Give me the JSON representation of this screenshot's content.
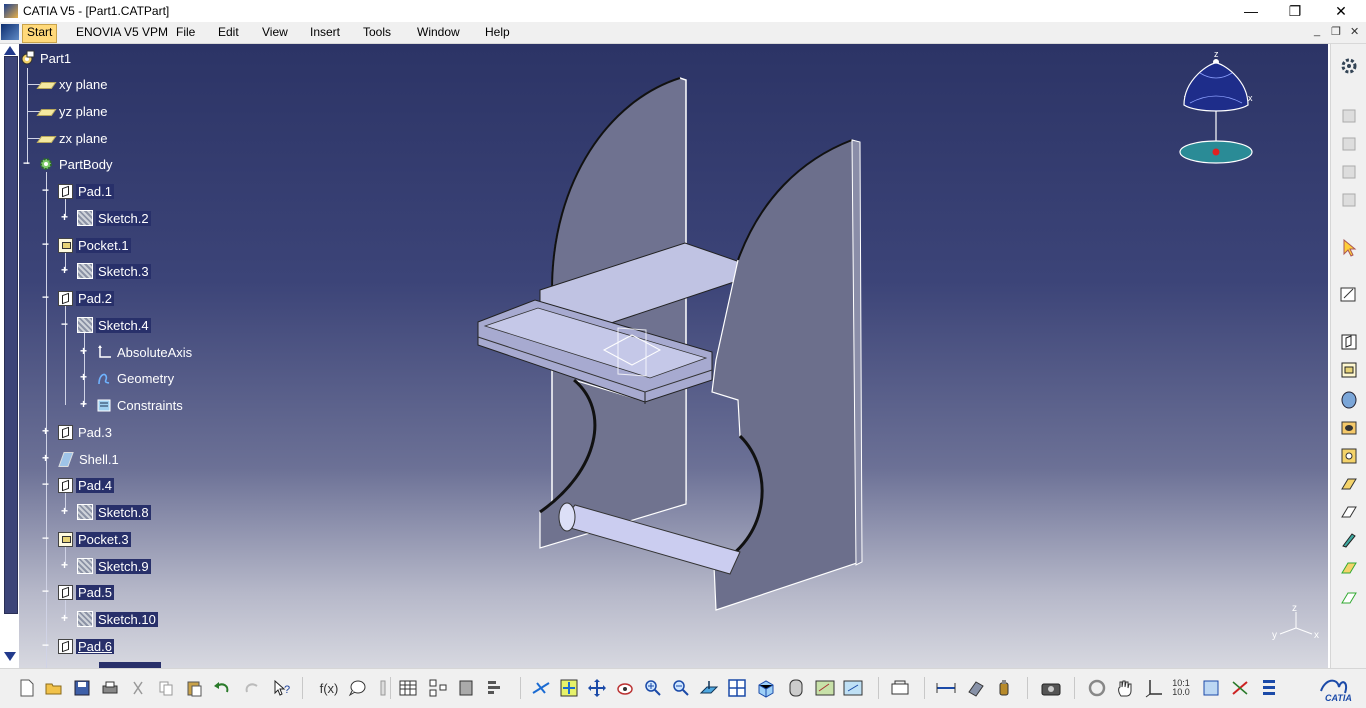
{
  "window": {
    "title": "CATIA V5 - [Part1.CATPart]",
    "minimize_glyph": "—",
    "restore_glyph": "❐",
    "close_glyph": "✕"
  },
  "menu": {
    "items": [
      "Start",
      "ENOVIA V5 VPM",
      "File",
      "Edit",
      "View",
      "Insert",
      "Tools",
      "Window",
      "Help"
    ],
    "mdi": {
      "minimize": "_",
      "restore": "❐",
      "close": "✕"
    }
  },
  "tree": {
    "nodes": [
      {
        "label": "Part1",
        "icon": "part-icon"
      },
      {
        "label": "xy plane",
        "icon": "plane-icon"
      },
      {
        "label": "yz plane",
        "icon": "plane-icon"
      },
      {
        "label": "zx plane",
        "icon": "plane-icon"
      },
      {
        "label": "PartBody",
        "icon": "body-icon"
      },
      {
        "label": "Pad.1",
        "icon": "pad-icon"
      },
      {
        "label": "Sketch.2",
        "icon": "sketch-icon"
      },
      {
        "label": "Pocket.1",
        "icon": "pocket-icon"
      },
      {
        "label": "Sketch.3",
        "icon": "sketch-icon"
      },
      {
        "label": "Pad.2",
        "icon": "pad-icon"
      },
      {
        "label": "Sketch.4",
        "icon": "sketch-icon"
      },
      {
        "label": "AbsoluteAxis",
        "icon": "axis-icon"
      },
      {
        "label": "Geometry",
        "icon": "geometry-icon"
      },
      {
        "label": "Constraints",
        "icon": "constraints-icon"
      },
      {
        "label": "Pad.3",
        "icon": "pad-icon"
      },
      {
        "label": "Shell.1",
        "icon": "shell-icon"
      },
      {
        "label": "Pad.4",
        "icon": "pad-icon"
      },
      {
        "label": "Sketch.8",
        "icon": "sketch-icon"
      },
      {
        "label": "Pocket.3",
        "icon": "pocket-icon"
      },
      {
        "label": "Sketch.9",
        "icon": "sketch-icon"
      },
      {
        "label": "Pad.5",
        "icon": "pad-icon"
      },
      {
        "label": "Sketch.10",
        "icon": "sketch-icon"
      },
      {
        "label": "Pad.6",
        "icon": "pad-icon"
      }
    ]
  },
  "compass": {
    "z": "z",
    "y": "y",
    "x": "x"
  },
  "axis_triad": {
    "z": "z",
    "y": "y",
    "x": "x"
  },
  "toolbars": {
    "bottom_text": {
      "formula": "f(x)",
      "ratio_top": "10:1",
      "ratio_bottom": "10.0"
    },
    "catia_logo": "CATIA"
  }
}
